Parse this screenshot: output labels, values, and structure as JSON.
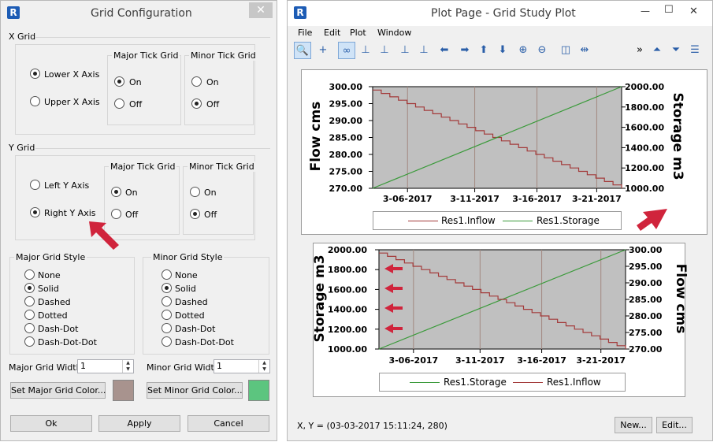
{
  "dialog": {
    "title": "Grid Configuration",
    "close_symbol": "✕",
    "x_grid": {
      "legend": "X Grid",
      "axis_options": [
        "Lower X Axis",
        "Upper X Axis"
      ],
      "major_title": "Major Tick Grid",
      "minor_title": "Minor Tick Grid",
      "on": "On",
      "off": "Off"
    },
    "y_grid": {
      "legend": "Y Grid",
      "axis_options": [
        "Left Y Axis",
        "Right Y Axis"
      ],
      "major_title": "Major Tick Grid",
      "minor_title": "Minor Tick Grid",
      "on": "On",
      "off": "Off"
    },
    "major_style": {
      "title": "Major Grid Style",
      "options": [
        "None",
        "Solid",
        "Dashed",
        "Dotted",
        "Dash-Dot",
        "Dash-Dot-Dot"
      ]
    },
    "minor_style": {
      "title": "Minor Grid Style",
      "options": [
        "None",
        "Solid",
        "Dashed",
        "Dotted",
        "Dash-Dot",
        "Dash-Dot-Dot"
      ]
    },
    "major_width_label": "Major Grid Width",
    "major_width_value": "1",
    "minor_width_label": "Minor Grid Width",
    "minor_width_value": "1",
    "major_color_button": "Set Major Grid Color...",
    "minor_color_button": "Set Minor Grid Color...",
    "major_color": "#a8938e",
    "minor_color": "#5cc57f",
    "ok": "Ok",
    "apply": "Apply",
    "cancel": "Cancel"
  },
  "plot_window": {
    "title": "Plot Page - Grid Study Plot",
    "window_controls": {
      "minimize": "—",
      "maximize": "☐",
      "close": "✕"
    },
    "menu": [
      "File",
      "Edit",
      "Plot",
      "Window"
    ],
    "toolbar_icons": [
      "zoom-icon",
      "crosshair-icon",
      "link-icon",
      "axis-icon",
      "axis-icon",
      "axis-icon",
      "axis-icon",
      "arrow-left-icon",
      "arrow-right-icon",
      "arrow-up-icon",
      "arrow-down-icon",
      "zoom-in-icon",
      "zoom-out-icon",
      "split-icon",
      "center-icon",
      "overflow-icon",
      "align-top-icon",
      "align-bottom-icon",
      "list-icon"
    ],
    "status_text": "X, Y = (03-03-2017 15:11:24, 280)",
    "new_button": "New...",
    "edit_button": "Edit..."
  },
  "chart_data": [
    {
      "type": "line",
      "x_ticks": [
        "3-06-2017",
        "3-11-2017",
        "3-16-2017",
        "3-21-2017"
      ],
      "left_axis": {
        "title": "Flow  cms",
        "ticks": [
          "300.00",
          "295.00",
          "290.00",
          "285.00",
          "280.00",
          "275.00",
          "270.00"
        ],
        "range": [
          270,
          300
        ]
      },
      "right_axis": {
        "title": "Storage  m3",
        "ticks": [
          "2000.00",
          "1800.00",
          "1600.00",
          "1400.00",
          "1200.00",
          "1000.00"
        ],
        "range": [
          1000,
          2000
        ]
      },
      "series": [
        {
          "name": "Res1.Inflow",
          "color": "#a33a3a",
          "axis": "left",
          "shape": "step-down",
          "start": 299,
          "end": 270
        },
        {
          "name": "Res1.Storage",
          "color": "#3a9a3a",
          "axis": "right",
          "shape": "linear",
          "start": 1000,
          "end": 2000
        }
      ],
      "legend": [
        "Res1.Inflow",
        "Res1.Storage"
      ],
      "grid": "vertical"
    },
    {
      "type": "line",
      "x_ticks": [
        "3-06-2017",
        "3-11-2017",
        "3-16-2017",
        "3-21-2017"
      ],
      "left_axis": {
        "title": "Storage  m3",
        "ticks": [
          "2000.00",
          "1800.00",
          "1600.00",
          "1400.00",
          "1200.00",
          "1000.00"
        ],
        "range": [
          1000,
          2000
        ]
      },
      "right_axis": {
        "title": "Flow  cms",
        "ticks": [
          "300.00",
          "295.00",
          "290.00",
          "285.00",
          "280.00",
          "275.00",
          "270.00"
        ],
        "range": [
          270,
          300
        ]
      },
      "series": [
        {
          "name": "Res1.Storage",
          "color": "#3a9a3a",
          "axis": "left",
          "shape": "linear",
          "start": 1000,
          "end": 2000
        },
        {
          "name": "Res1.Inflow",
          "color": "#a33a3a",
          "axis": "right",
          "shape": "step-down",
          "start": 299,
          "end": 270
        }
      ],
      "legend": [
        "Res1.Storage",
        "Res1.Inflow"
      ],
      "grid": "vertical"
    }
  ]
}
